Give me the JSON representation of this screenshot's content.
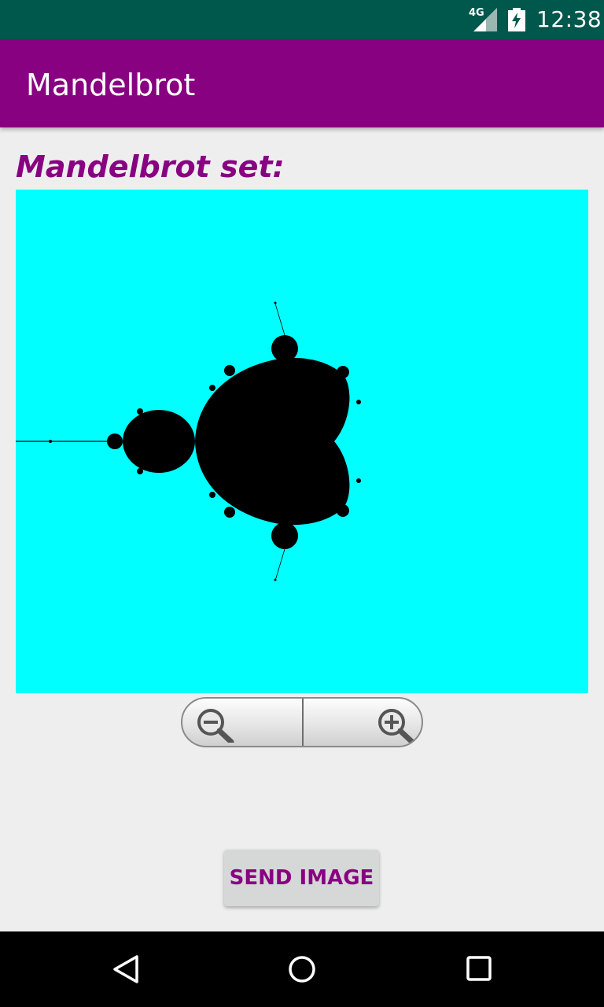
{
  "status_bar": {
    "network_label": "4G",
    "time": "12:38",
    "icons": [
      "signal-icon",
      "battery-charging-icon"
    ]
  },
  "app_bar": {
    "title": "Mandelbrot"
  },
  "main": {
    "heading": "Mandelbrot set:",
    "fractal": {
      "background": "#00FFFF",
      "set_color": "#000000"
    },
    "zoom_controls": {
      "icons": [
        "zoom-out-icon",
        "zoom-in-icon"
      ]
    },
    "send_button_label": "SEND IMAGE"
  },
  "nav_bar": {
    "icons": [
      "back-icon",
      "home-icon",
      "recents-icon"
    ]
  },
  "colors": {
    "status_bar": "#00574B",
    "app_bar": "#880180",
    "accent": "#880180",
    "background": "#EEEEEE"
  }
}
